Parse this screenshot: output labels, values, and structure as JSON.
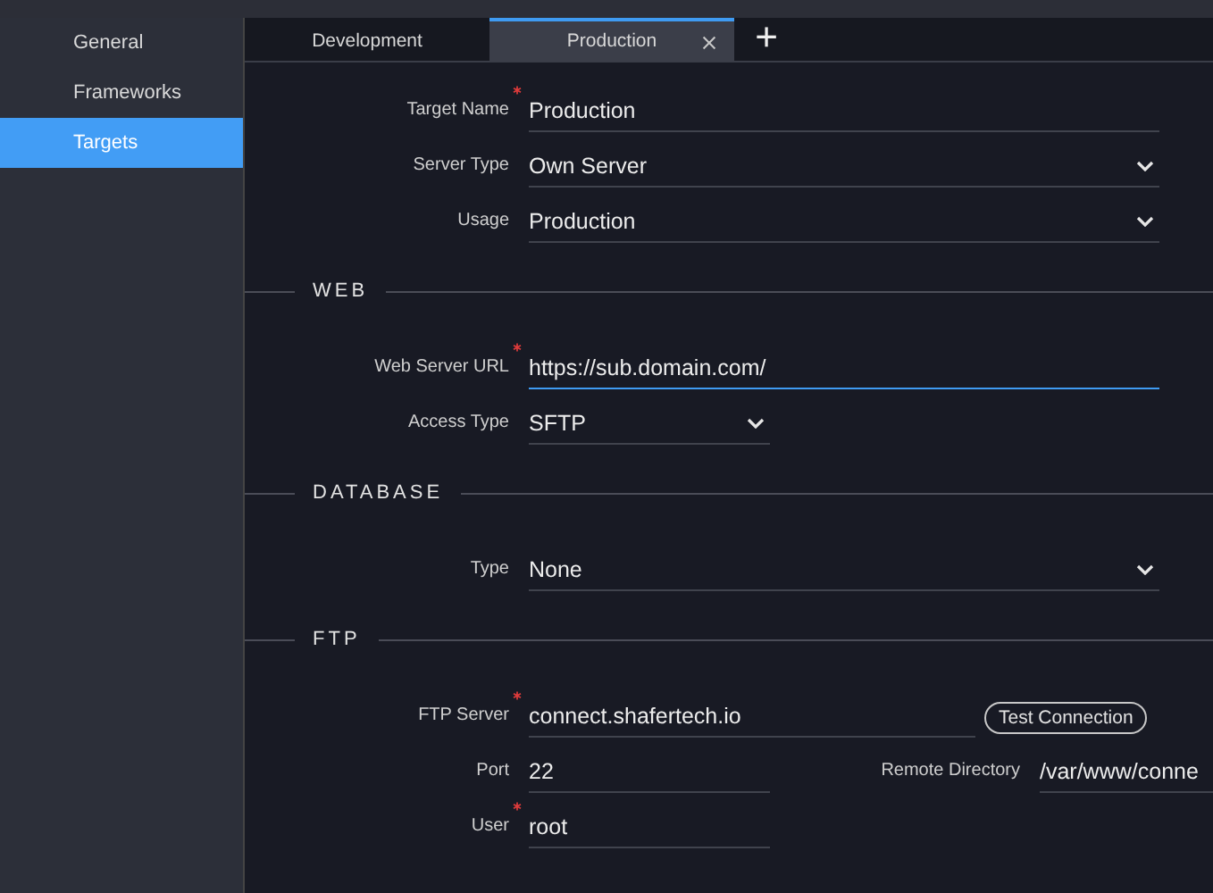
{
  "sidebar": {
    "items": [
      {
        "label": "General",
        "selected": false
      },
      {
        "label": "Frameworks",
        "selected": false
      },
      {
        "label": "Targets",
        "selected": true
      }
    ]
  },
  "tabs": [
    {
      "label": "Development",
      "selected": false,
      "closable": false
    },
    {
      "label": "Production",
      "selected": true,
      "closable": true
    }
  ],
  "title_bar": {
    "kind": "blank"
  },
  "add_tab": "+",
  "sections": [
    {
      "rows": [
        {
          "fields": [
            {
              "label": "Target Name",
              "required": true,
              "kind": "text",
              "value": "Production",
              "focused": false
            }
          ]
        },
        {
          "fields": [
            {
              "label": "Server Type",
              "required": false,
              "kind": "select",
              "value": "Own Server",
              "focused": false
            }
          ]
        },
        {
          "fields": [
            {
              "label": "Usage",
              "required": false,
              "kind": "select",
              "value": "Production",
              "focused": false
            }
          ]
        }
      ]
    },
    {
      "title": "WEB",
      "rows": [
        {
          "fields": [
            {
              "label": "Web Server URL",
              "required": true,
              "kind": "text",
              "value": "https://sub.domain.com/",
              "focused": true
            }
          ]
        },
        {
          "fields": [
            {
              "label": "Access Type",
              "required": false,
              "kind": "select",
              "value": "SFTP",
              "focused": false
            }
          ]
        }
      ]
    },
    {
      "title": "DATABASE",
      "rows": [
        {
          "fields": [
            {
              "label": "Type",
              "required": false,
              "kind": "select",
              "value": "None",
              "focused": false
            }
          ]
        }
      ]
    },
    {
      "title": "FTP",
      "rows": [
        {
          "fields": [
            {
              "label": "FTP Server",
              "required": true,
              "kind": "text",
              "value": "connect.shafertech.io",
              "focused": false
            }
          ],
          "button": "Test Connection"
        },
        {
          "fields": [
            {
              "label": "Port",
              "required": false,
              "kind": "text",
              "value": "22",
              "focused": false
            },
            {
              "label": "Remote Directory",
              "required": false,
              "kind": "text",
              "value": "/var/www/conne",
              "focused": false
            }
          ]
        },
        {
          "fields": [
            {
              "label": "User",
              "required": true,
              "kind": "text",
              "value": "root",
              "focused": false
            }
          ]
        }
      ]
    }
  ]
}
